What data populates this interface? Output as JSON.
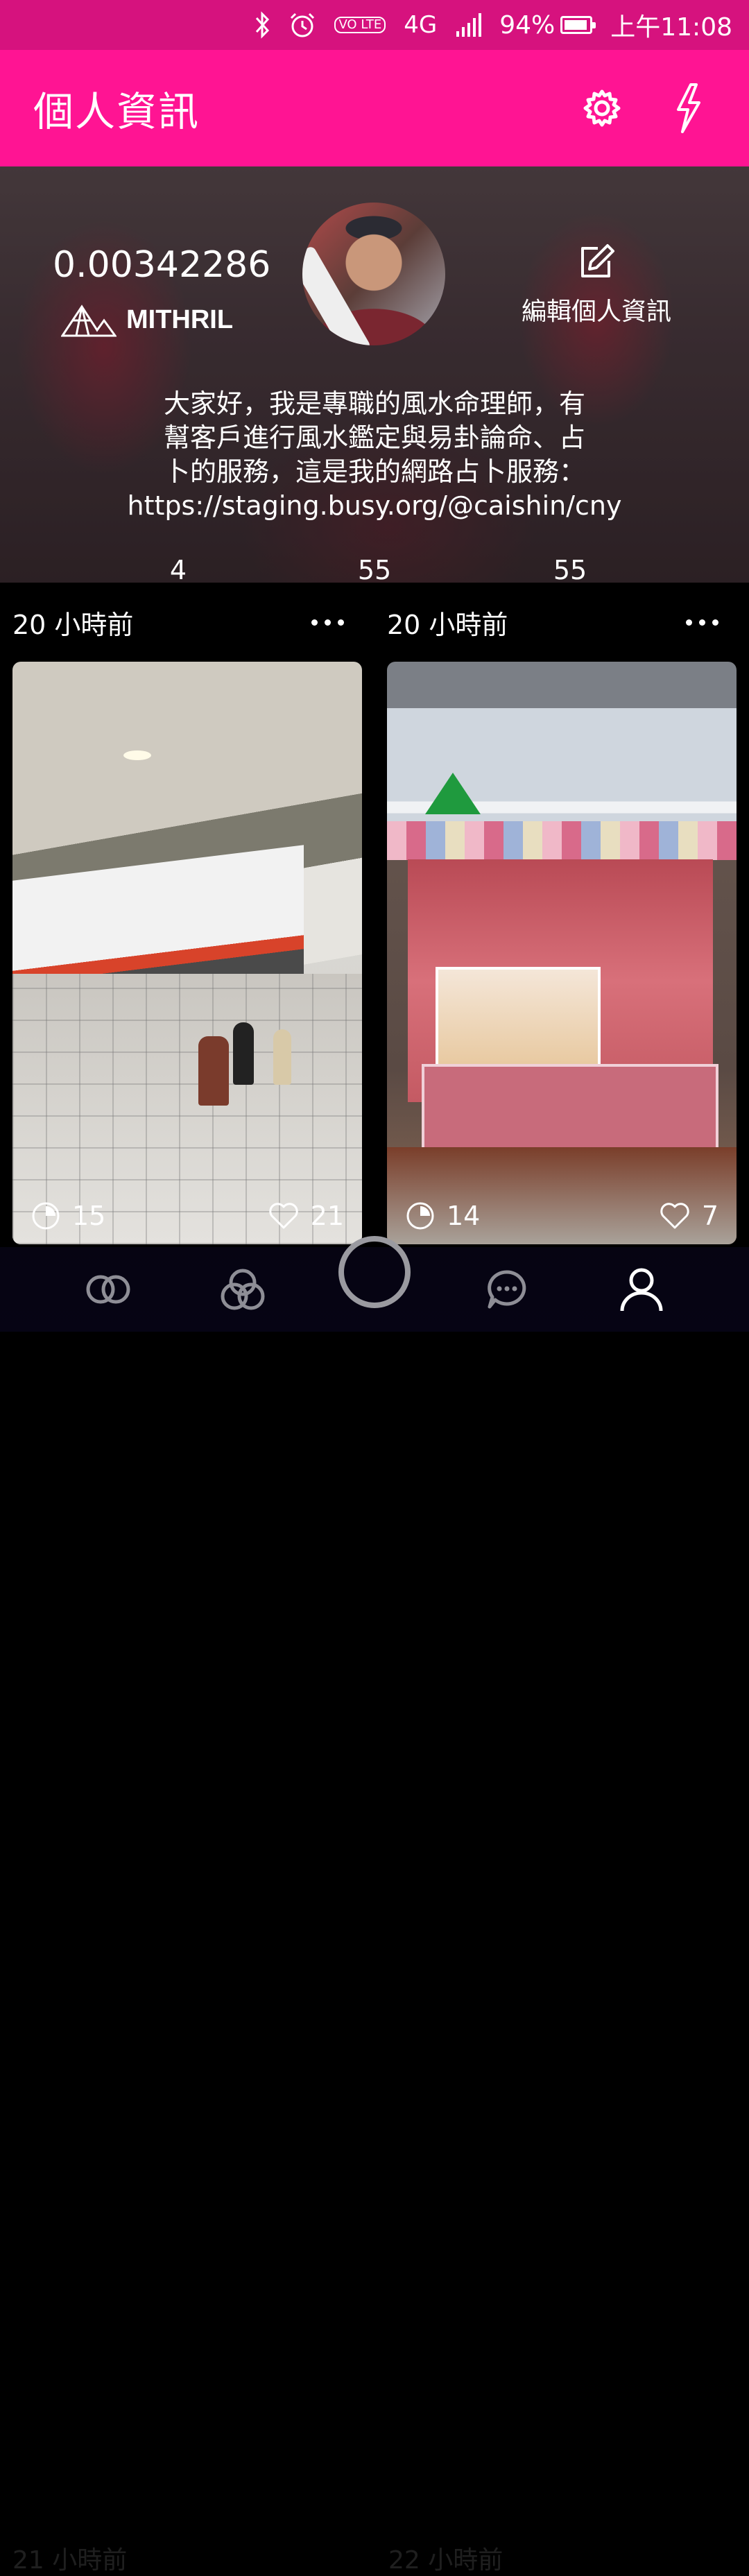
{
  "status_bar": {
    "network": "4G",
    "volte": "VO LTE",
    "battery_percent": "94%",
    "battery_level": 0.94,
    "time": "上午11:08",
    "icons": [
      "bluetooth-icon",
      "alarm-icon",
      "volte-icon",
      "signal-icon",
      "battery-icon"
    ]
  },
  "app_bar": {
    "title": "個人資訊",
    "settings_icon": "gear-icon",
    "boost_icon": "lightning-icon"
  },
  "profile": {
    "balance": "0.00342286",
    "token_label": "MITHRIL",
    "edit_label": "編輯個人資訊",
    "bio": "大家好，我是專職的風水命理師，有幫客戶進行風水鑑定與易卦論命、占卜的服務，這是我的網路占卜服務：https://staging.busy.org/@caishin/cny",
    "bio_lines": [
      "大家好，我是專職的風水命理師，有",
      "幫客戶進行風水鑑定與易卦論命、占",
      "卜的服務，這是我的網路占卜服務：",
      "https://staging.busy.org/@caishin/cny"
    ],
    "stats": [
      "4",
      "55",
      "55"
    ]
  },
  "feed": {
    "cards": [
      {
        "time": "20 小時前",
        "views": "15",
        "likes": "21",
        "image": "train-platform-photo"
      },
      {
        "time": "20 小時前",
        "views": "14",
        "likes": "7",
        "image": "bakery-stall-photo"
      }
    ],
    "next_row_times": [
      "21 小時前",
      "22 小時前"
    ]
  },
  "bottom_nav": {
    "items": [
      "rings-icon",
      "venn-icon",
      "camera-ring-icon",
      "chat-icon",
      "profile-icon"
    ],
    "active": "profile-icon"
  },
  "colors": {
    "status_bar": "#d6127e",
    "app_bar": "#ff1493",
    "feed_bg": "#000000",
    "nav_bg": "#060414"
  }
}
